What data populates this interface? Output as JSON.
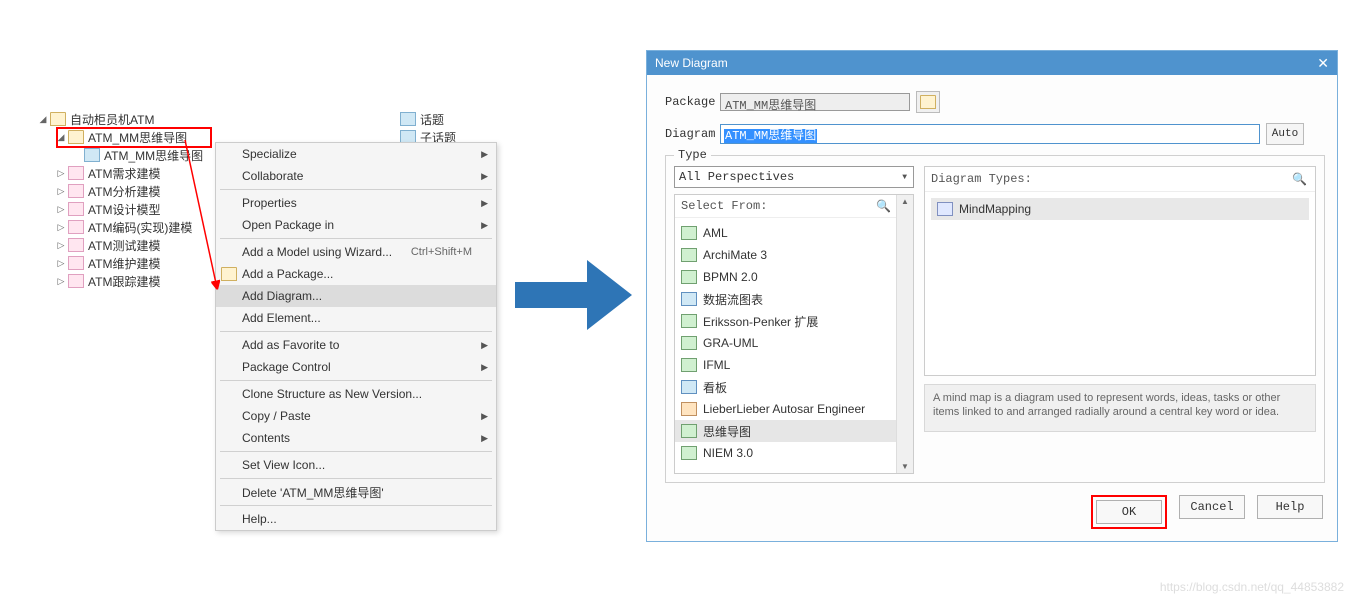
{
  "tree": {
    "root": "自动柜员机ATM",
    "highlighted": "ATM_MM思维导图",
    "child": "ATM_MM思维导图",
    "items": [
      "ATM需求建模",
      "ATM分析建模",
      "ATM设计模型",
      "ATM编码(实现)建模",
      "ATM测试建模",
      "ATM维护建模",
      "ATM跟踪建模"
    ]
  },
  "right_tree": {
    "a": "话题",
    "b": "子话题"
  },
  "menu": {
    "specialize": "Specialize",
    "collaborate": "Collaborate",
    "properties": "Properties",
    "open_in": "Open Package in",
    "add_model": "Add a Model using Wizard...",
    "add_model_shortcut": "Ctrl+Shift+M",
    "add_package": "Add a Package...",
    "add_diagram": "Add Diagram...",
    "add_element": "Add Element...",
    "add_favorite": "Add as Favorite to",
    "package_control": "Package Control",
    "clone": "Clone Structure as New Version...",
    "copy_paste": "Copy / Paste",
    "contents": "Contents",
    "set_view": "Set View Icon...",
    "delete": "Delete 'ATM_MM思维导图'",
    "help": "Help..."
  },
  "dialog": {
    "title": "New Diagram",
    "package_label": "Package",
    "package_value": "ATM_MM思维导图",
    "diagram_label": "Diagram",
    "diagram_value": "ATM_MM思维导图",
    "auto": "Auto",
    "type_label": "Type",
    "perspectives": "All Perspectives",
    "select_from": "Select From:",
    "select_items": [
      "AML",
      "ArchiMate 3",
      "BPMN 2.0",
      "数据流图表",
      "Eriksson-Penker 扩展",
      "GRA-UML",
      "IFML",
      "看板",
      "LieberLieber Autosar Engineer",
      "思维导图",
      "NIEM 3.0"
    ],
    "selected_index": 9,
    "types_label": "Diagram Types:",
    "type_item": "MindMapping",
    "description": "A mind map is a diagram used to represent words, ideas, tasks or other items linked to and arranged radially around a central key word or idea.",
    "ok": "OK",
    "cancel": "Cancel",
    "help": "Help"
  },
  "watermark": "https://blog.csdn.net/qq_44853882"
}
